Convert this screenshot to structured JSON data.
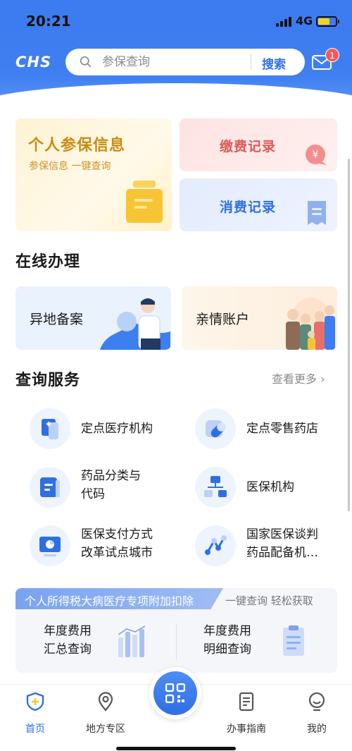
{
  "status_bar": {
    "time": "20:21",
    "network": "4G"
  },
  "header": {
    "logo": "CHS",
    "search_placeholder": "参保查询",
    "search_button": "搜索",
    "message_badge": "1"
  },
  "top_cards": {
    "personal": {
      "title": "个人参保信息",
      "subtitle": "参保信息 一键查询"
    },
    "payment": {
      "title": "缴费记录"
    },
    "consumption": {
      "title": "消费记录"
    }
  },
  "online": {
    "title": "在线办理",
    "items": [
      {
        "label": "异地备案"
      },
      {
        "label": "亲情账户"
      }
    ]
  },
  "query": {
    "title": "查询服务",
    "more": "查看更多",
    "items": [
      {
        "lines": [
          "定点医疗机构"
        ],
        "icon": "medical-kit-icon"
      },
      {
        "lines": [
          "定点零售药店"
        ],
        "icon": "pill-icon"
      },
      {
        "lines": [
          "药品分类与",
          "代码"
        ],
        "icon": "document-icon"
      },
      {
        "lines": [
          "医保机构"
        ],
        "icon": "organization-icon"
      },
      {
        "lines": [
          "医保支付方式",
          "改革试点城市"
        ],
        "icon": "monitor-chart-icon"
      },
      {
        "lines": [
          "国家医保谈判",
          "药品配备机…"
        ],
        "icon": "network-nodes-icon"
      }
    ]
  },
  "tax": {
    "banner": "个人所得税大病医疗专项附加扣除",
    "note": "一键查询 轻松获取",
    "items": [
      {
        "lines": [
          "年度费用",
          "汇总查询"
        ]
      },
      {
        "lines": [
          "年度费用",
          "明细查询"
        ]
      }
    ]
  },
  "tabbar": {
    "items": [
      {
        "label": "首页",
        "active": true
      },
      {
        "label": "地方专区"
      },
      {
        "label": "办事指南"
      },
      {
        "label": "我的"
      }
    ]
  },
  "colors": {
    "primary": "#2f6fe4",
    "header": "#3c7bf0",
    "gold": "#c78d12",
    "red": "#e05757"
  }
}
